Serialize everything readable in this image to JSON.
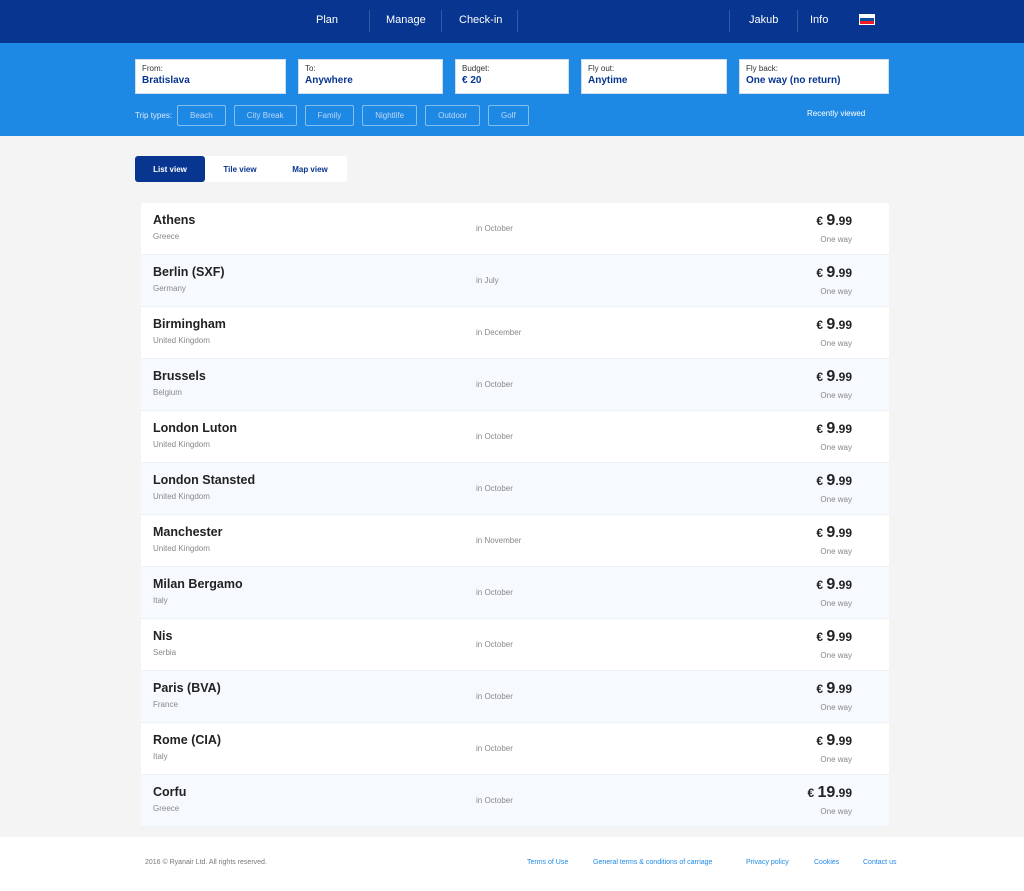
{
  "header": {
    "nav": [
      "Plan",
      "Manage",
      "Check-in"
    ],
    "user": "Jakub",
    "info": "Info",
    "flag_icon": "slovakia-flag-icon"
  },
  "search": {
    "from": {
      "label": "From:",
      "value": "Bratislava"
    },
    "to": {
      "label": "To:",
      "value": "Anywhere"
    },
    "budget": {
      "label": "Budget:",
      "value": "€ 20"
    },
    "fly_out": {
      "label": "Fly out:",
      "value": "Anytime"
    },
    "fly_back": {
      "label": "Fly back:",
      "value": "One way (no return)"
    },
    "trip_types_label": "Trip types:",
    "trip_types": [
      "Beach",
      "City Break",
      "Family",
      "Nightlife",
      "Outdoor",
      "Golf"
    ],
    "recently_viewed": "Recently viewed"
  },
  "views": {
    "list": "List view",
    "tile": "Tile view",
    "map": "Map view",
    "active": "list"
  },
  "results": [
    {
      "city": "Athens",
      "country": "Greece",
      "when": "in October",
      "currency": "€",
      "int": "9",
      "dec": ".99",
      "type": "One way"
    },
    {
      "city": "Berlin (SXF)",
      "country": "Germany",
      "when": "in July",
      "currency": "€",
      "int": "9",
      "dec": ".99",
      "type": "One way"
    },
    {
      "city": "Birmingham",
      "country": "United Kingdom",
      "when": "in December",
      "currency": "€",
      "int": "9",
      "dec": ".99",
      "type": "One way"
    },
    {
      "city": "Brussels",
      "country": "Belgium",
      "when": "in October",
      "currency": "€",
      "int": "9",
      "dec": ".99",
      "type": "One way"
    },
    {
      "city": "London Luton",
      "country": "United Kingdom",
      "when": "in October",
      "currency": "€",
      "int": "9",
      "dec": ".99",
      "type": "One way"
    },
    {
      "city": "London Stansted",
      "country": "United Kingdom",
      "when": "in October",
      "currency": "€",
      "int": "9",
      "dec": ".99",
      "type": "One way"
    },
    {
      "city": "Manchester",
      "country": "United Kingdom",
      "when": "in November",
      "currency": "€",
      "int": "9",
      "dec": ".99",
      "type": "One way"
    },
    {
      "city": "Milan Bergamo",
      "country": "Italy",
      "when": "in October",
      "currency": "€",
      "int": "9",
      "dec": ".99",
      "type": "One way"
    },
    {
      "city": "Nis",
      "country": "Serbia",
      "when": "in October",
      "currency": "€",
      "int": "9",
      "dec": ".99",
      "type": "One way"
    },
    {
      "city": "Paris (BVA)",
      "country": "France",
      "when": "in October",
      "currency": "€",
      "int": "9",
      "dec": ".99",
      "type": "One way"
    },
    {
      "city": "Rome (CIA)",
      "country": "Italy",
      "when": "in October",
      "currency": "€",
      "int": "9",
      "dec": ".99",
      "type": "One way"
    },
    {
      "city": "Corfu",
      "country": "Greece",
      "when": "in October",
      "currency": "€",
      "int": "19",
      "dec": ".99",
      "type": "One way"
    }
  ],
  "footer": {
    "copyright": "2016 © Ryanair Ltd. All rights reserved.",
    "links": [
      "Terms of Use",
      "General terms & conditions of carriage",
      "Privacy policy",
      "Cookies",
      "Contact us"
    ]
  },
  "colors": {
    "header": "#073590",
    "search_bar": "#1e89e4",
    "accent": "#073590",
    "link": "#1e89e4"
  }
}
